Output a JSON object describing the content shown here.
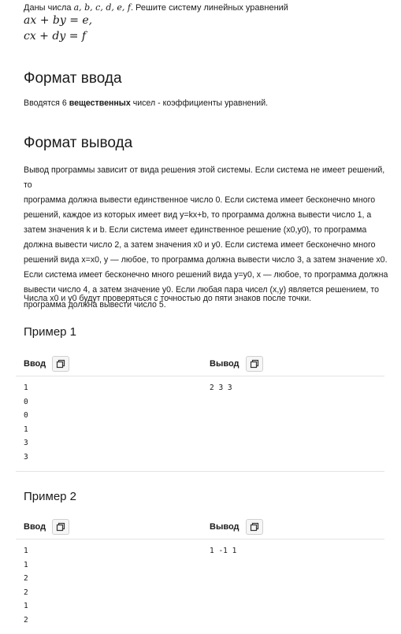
{
  "intro": {
    "prefix": "Даны числа ",
    "vars": "a, b, c, d, e, f",
    "suffix": ". Решите систему линейных уравнений"
  },
  "equations": [
    "ax + by = e,",
    "cx + dy = f"
  ],
  "input_format": {
    "title": "Формат ввода",
    "pre": "Вводятся 6 ",
    "bold": "вещественных",
    "post": " чисел - коэффициенты уравнений."
  },
  "output_format": {
    "title": "Формат вывода",
    "lines": [
      "Вывод программы зависит от вида решения этой системы. Если система не имеет решений, то",
      "программа должна вывести единственное число 0. Если система имеет бесконечно много",
      "решений, каждое из которых имеет вид y=kx+b, то программа должна вывести число 1, а",
      "затем значения k и b. Если система имеет единственное решение (x0,y0), то программа",
      "должна вывести число 2, а затем значения x0 и y0. Если система имеет бесконечно много",
      "решений вида x=x0, y — любое, то программа должна вывести число 3, а затем значение x0.",
      "Если система имеет бесконечно много решений вида y=y0, x — любое, то программа должна",
      "вывести число 4, а затем значение y0. Если любая пара чисел (x,y) является решением, то",
      "программа должна вывести число 5."
    ],
    "precision_note": "Числа x0 и y0 будут проверяться с точностью до пяти знаков после точки."
  },
  "examples": [
    {
      "title": "Пример 1",
      "input_label": "Ввод",
      "output_label": "Вывод",
      "input": "1\n0\n0\n1\n3\n3",
      "output": "2 3 3"
    },
    {
      "title": "Пример 2",
      "input_label": "Ввод",
      "output_label": "Вывод",
      "input": "1\n1\n2\n2\n1\n2",
      "output": "1 -1 1"
    }
  ]
}
